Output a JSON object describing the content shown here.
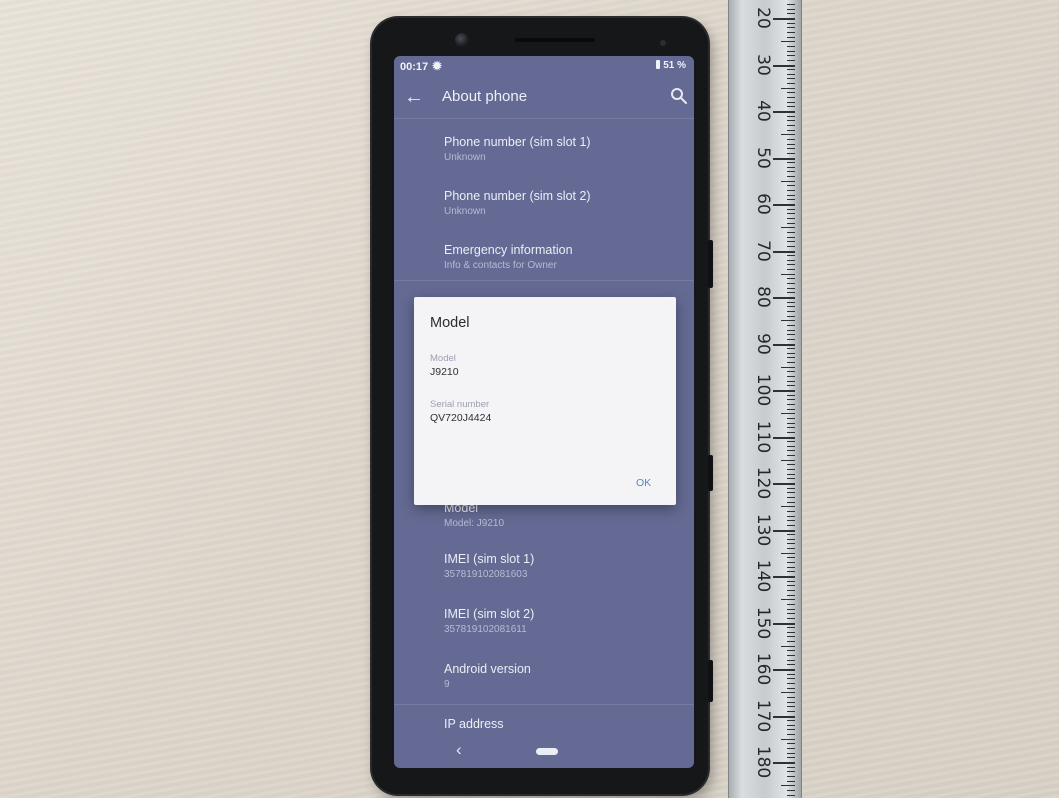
{
  "status_bar": {
    "time": "00:17",
    "battery": "51 %"
  },
  "app_bar": {
    "title": "About phone"
  },
  "settings": [
    {
      "title": "Phone number (sim slot 1)",
      "subtitle": "Unknown"
    },
    {
      "title": "Phone number (sim slot 2)",
      "subtitle": "Unknown"
    },
    {
      "title": "Emergency information",
      "subtitle": "Info & contacts for Owner"
    },
    {
      "title": "Model",
      "subtitle": "Model: J9210"
    },
    {
      "title": "IMEI (sim slot 1)",
      "subtitle": "357819102081603"
    },
    {
      "title": "IMEI (sim slot 2)",
      "subtitle": "357819102081611"
    },
    {
      "title": "Android version",
      "subtitle": "9"
    },
    {
      "title": "IP address",
      "subtitle": ""
    }
  ],
  "dialog": {
    "title": "Model",
    "model_label": "Model",
    "model_value": "J9210",
    "serial_label": "Serial number",
    "serial_value": "QV720J4424",
    "ok_label": "OK"
  },
  "ruler": {
    "numbers": [
      "20",
      "30",
      "40",
      "50",
      "60",
      "70",
      "80",
      "90",
      "100",
      "110",
      "120",
      "130",
      "140",
      "150",
      "160",
      "170",
      "180"
    ]
  },
  "icons": [
    "gear-icon",
    "battery-icon",
    "back-arrow-icon",
    "search-icon",
    "nav-back-icon",
    "nav-home-pill"
  ],
  "colors": {
    "screen_background": "#646a93",
    "dialog_background": "#f4f4f7",
    "accent": "#5e87b5"
  }
}
